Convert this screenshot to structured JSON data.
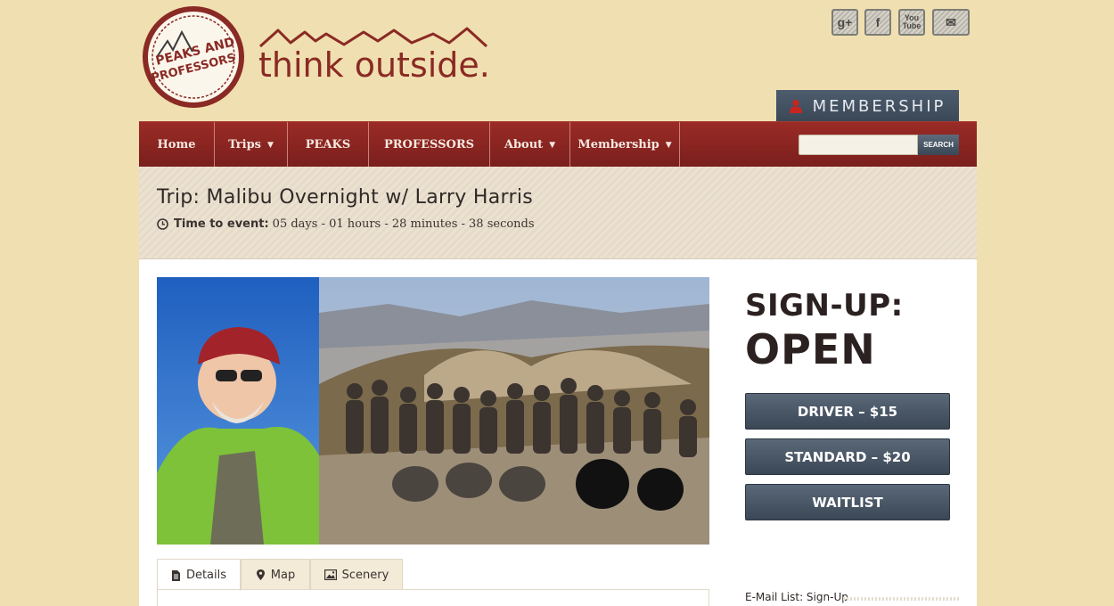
{
  "brand": {
    "seal_text": "PEAKS AND PROFESSORS",
    "tagline": "think outside."
  },
  "social": [
    {
      "name": "google-plus",
      "glyph": "g+"
    },
    {
      "name": "facebook",
      "glyph": "f"
    },
    {
      "name": "youtube",
      "glyph": "You Tube"
    },
    {
      "name": "email",
      "glyph": "✉"
    }
  ],
  "membership_tab": {
    "label": "MEMBERSHIP"
  },
  "nav": {
    "items": [
      {
        "label": "Home"
      },
      {
        "label": "Trips"
      },
      {
        "label": "PEAKS"
      },
      {
        "label": "PROFESSORS"
      },
      {
        "label": "About"
      },
      {
        "label": "Membership"
      }
    ],
    "search_placeholder": "",
    "search_button": "SEARCH"
  },
  "trip": {
    "title": "Trip: Malibu Overnight w/ Larry Harris",
    "time_label": "Time to event:",
    "time_value": "05 days - 01 hours - 28 minutes - 38 seconds"
  },
  "signup": {
    "heading": "SIGN-UP:",
    "status": "OPEN",
    "buttons": [
      {
        "label": "DRIVER – $15"
      },
      {
        "label": "STANDARD – $20"
      },
      {
        "label": "WAITLIST"
      }
    ]
  },
  "tabs": [
    {
      "label": "Details"
    },
    {
      "label": "Map"
    },
    {
      "label": "Scenery"
    }
  ],
  "email_list": {
    "label": "E-Mail List: Sign-Up"
  },
  "colors": {
    "page_bg": "#f0dfb0",
    "nav_red": "#8a2420",
    "button_slate": "#4a5767",
    "brand_red": "#8a2a24"
  }
}
